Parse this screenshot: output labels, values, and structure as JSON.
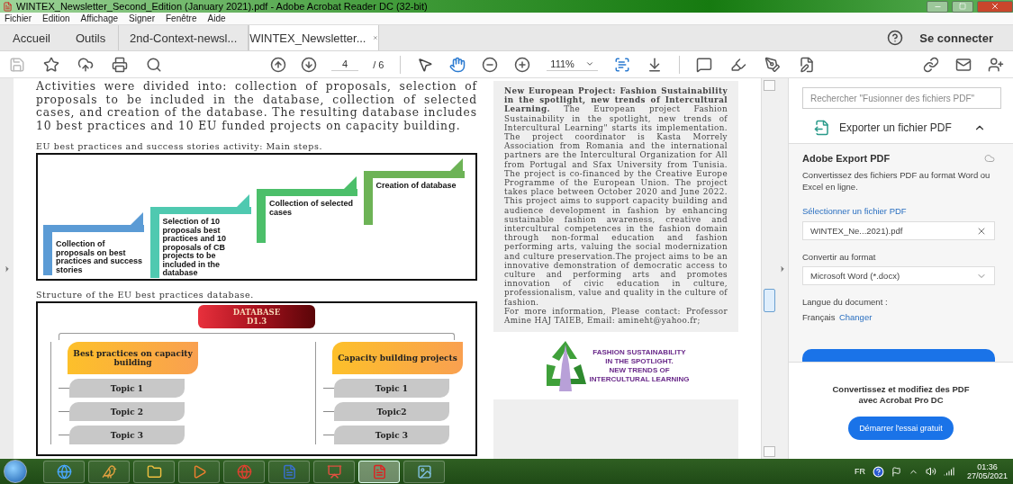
{
  "window": {
    "title": "WINTEX_Newsletter_Second_Edition  (January 2021).pdf - Adobe Acrobat Reader DC (32-bit)"
  },
  "menu": [
    "Fichier",
    "Edition",
    "Affichage",
    "Signer",
    "Fenêtre",
    "Aide"
  ],
  "tabs": [
    {
      "label": "Accueil",
      "kind": "nav",
      "selected": false
    },
    {
      "label": "Outils",
      "kind": "nav",
      "selected": false
    },
    {
      "label": "2nd-Context-newsl...",
      "kind": "doc",
      "selected": false
    },
    {
      "label": "WINTEX_Newsletter...",
      "kind": "doc",
      "selected": true
    }
  ],
  "account": {
    "sign_in": "Se connecter"
  },
  "toolbar": {
    "file_tools": [
      {
        "kind": "save",
        "disabled": true
      },
      {
        "kind": "star",
        "disabled": false
      },
      {
        "kind": "upload",
        "disabled": false
      },
      {
        "kind": "print",
        "disabled": false
      },
      {
        "kind": "find",
        "disabled": false
      }
    ],
    "page": "4",
    "page_total": "/ 6",
    "select_tools": [
      {
        "kind": "pointer",
        "selected": false
      },
      {
        "kind": "hand",
        "selected": true
      }
    ],
    "zoom": "111%"
  },
  "document": {
    "intro": "Activities were divided into: collection of proposals, selection of proposals to be included in the database, collection of selected cases, and creation of the database. The resulting database includes 10 best practices and 10 EU funded projects on capacity building.",
    "figure_1": {
      "caption": "EU best practices and success stories activity: Main steps.",
      "steps": [
        "Collection of proposals on best practices and success stories",
        "Selection of 10 proposals best practices and 10 proposals of CB projects to be included in the database",
        "Collection of selected cases",
        "Creation of database"
      ]
    },
    "figure_2": {
      "caption": "Structure of the EU best practices database.",
      "root": "DATABASE D1.3",
      "branches": [
        {
          "title": "Best practices on capacity building",
          "topics": [
            "Topic 1",
            "Topic 2",
            "Topic 3"
          ]
        },
        {
          "title": "Capacity building projects",
          "topics": [
            "Topic 1",
            "Topic2",
            "Topic 3"
          ]
        }
      ]
    },
    "article": {
      "text": "**New European Project: Fashion Sustainability in the spotlight, new trends of Intercultural Learning.** The European project Fashion Sustainability in the spotlight, new trends of Intercultural Learning\" starts its implementation. The project coordinator is Kasta Morrely Association from Romania and the international partners are the Intercultural Organization for All from Portugal and Sfax University from Tunisia. The project is co-financed by the Creative Europe Programme of the European Union. The project takes place between October 2020 and June 2022. This project aims to support capacity building and audience development in fashion by enhancing sustainable fashion awareness, creative and intercultural competences in the fashion domain through non-formal education and fashion performing arts, valuing the social modernization and culture preservation.The project aims to be an innovative demonstration of democratic access to culture and performing arts and promotes innovation of civic education in culture, professionalism, value and quality in the culture of fashion.",
      "contact": "For more information, Please contact: Professor Amine HAJ TAIEB, Email: amineht@yahoo.fr;"
    },
    "logo": {
      "lines": [
        "FASHION SUSTAINABILITY",
        "IN THE SPOTLIGHT.",
        "NEW TRENDS OF",
        "INTERCULTURAL LEARNING"
      ]
    }
  },
  "side_pane": {
    "search_placeholder": "Rechercher \"Fusionner des fichiers PDF\"",
    "section": {
      "title": "Exporter un fichier PDF",
      "expanded": true
    },
    "heading": "Adobe Export PDF",
    "description": "Convertissez des fichiers PDF au format Word ou Excel en ligne.",
    "select_link": "Sélectionner un fichier PDF",
    "file": "WINTEX_Ne...2021).pdf",
    "convert_label": "Convertir au format",
    "format": "Microsoft Word (*.docx)",
    "language_label": "Langue du document :",
    "language": "Français",
    "change_link": "Changer",
    "promo": "Convertissez et modifiez des PDF avec Acrobat Pro DC",
    "trial_button": "Démarrer l'essai gratuit"
  },
  "taskbar": {
    "apps": [
      {
        "kind": "browser",
        "selected": false
      },
      {
        "kind": "mascot",
        "selected": false
      },
      {
        "kind": "folder",
        "selected": false
      },
      {
        "kind": "media",
        "selected": false
      },
      {
        "kind": "chrome",
        "selected": false
      },
      {
        "kind": "word",
        "selected": false
      },
      {
        "kind": "slides",
        "selected": false
      },
      {
        "kind": "acrobat",
        "selected": true
      },
      {
        "kind": "photos",
        "selected": false
      }
    ],
    "language": "FR",
    "time": "01:36",
    "date": "27/05/2021"
  }
}
